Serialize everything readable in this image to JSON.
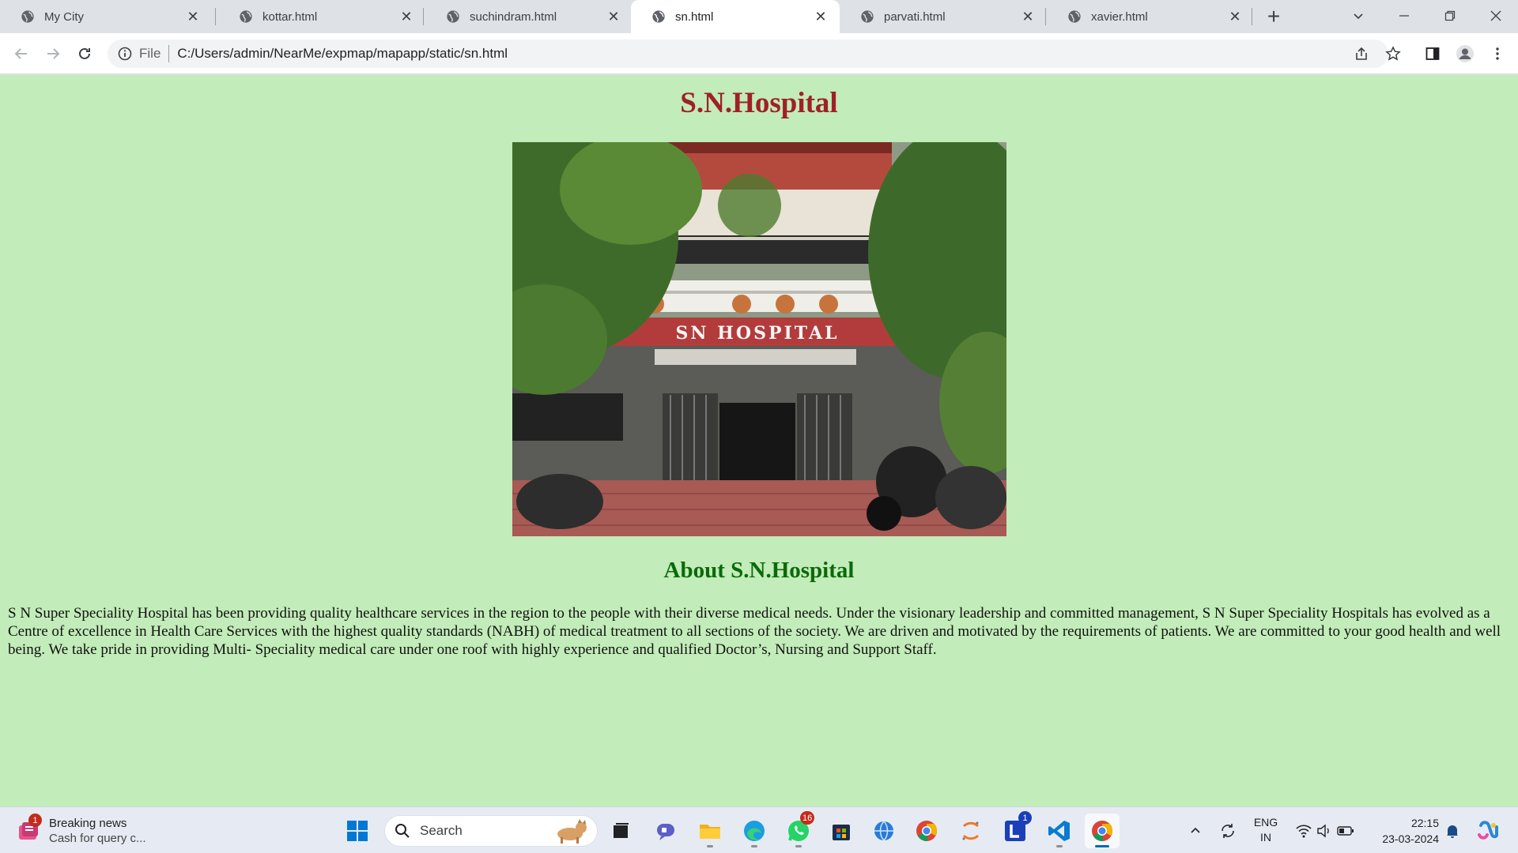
{
  "browser": {
    "tabs": [
      {
        "label": "My City"
      },
      {
        "label": "kottar.html"
      },
      {
        "label": "suchindram.html"
      },
      {
        "label": "sn.html"
      },
      {
        "label": "parvati.html"
      },
      {
        "label": "xavier.html"
      }
    ],
    "new_tab_symbol": "+",
    "close_symbol": "✕",
    "address": {
      "scheme": "File",
      "url": "C:/Users/admin/NearMe/expmap/mapapp/static/sn.html"
    }
  },
  "page": {
    "title": "S.N.Hospital",
    "photo_sign_text": "SN HOSPITAL",
    "about_heading": "About S.N.Hospital",
    "about_text": "S N Super Speciality Hospital has been providing quality healthcare services in the region to the people with their diverse medical needs. Under the visionary leadership and committed management, S N Super Speciality Hospitals has evolved as a Centre of excellence in Health Care Services with the highest quality standards (NABH) of medical treatment to all sections of the society. We are driven and motivated by the requirements of patients. We are committed to your good health and well being. We take pride in providing Multi- Speciality medical care under one roof with highly experience and qualified Doctor’s, Nursing and Support Staff.",
    "background_color": "#c2ecb9",
    "title_color": "#a02028",
    "heading_color": "#0a6a0a"
  },
  "taskbar": {
    "news": {
      "title": "Breaking news",
      "subtitle": "Cash for query c...",
      "badge": "1"
    },
    "search_placeholder": "Search",
    "whatsapp_badge": "16",
    "l_app_badge": "1",
    "language": {
      "line1": "ENG",
      "line2": "IN"
    },
    "clock": {
      "time": "22:15",
      "date": "23-03-2024"
    }
  }
}
